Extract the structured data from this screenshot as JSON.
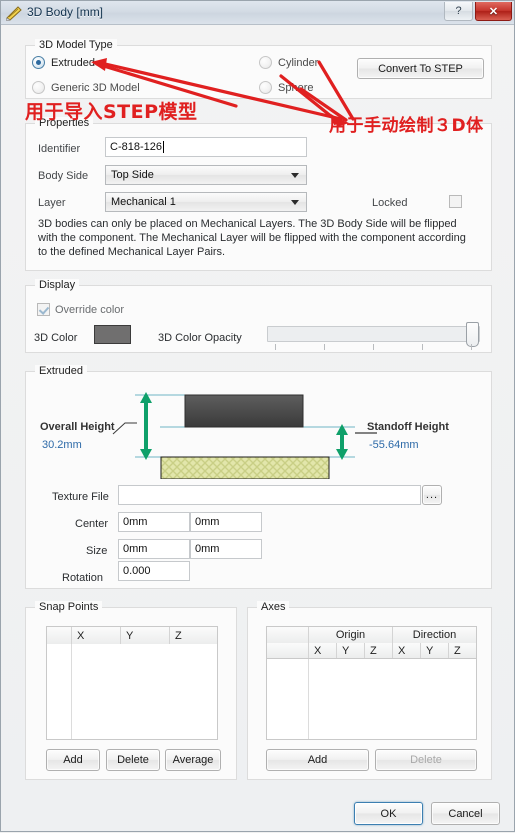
{
  "window": {
    "title": "3D Body [mm]",
    "icon": "3d-body-icon",
    "help_label": "?",
    "close_label": "✕"
  },
  "model_type": {
    "group_title": "3D Model Type",
    "options": [
      {
        "label": "Extruded",
        "selected": true
      },
      {
        "label": "Generic 3D Model",
        "selected": false
      },
      {
        "label": "Cylinder",
        "selected": false
      },
      {
        "label": "Sphere",
        "selected": false
      }
    ],
    "convert_button": "Convert To STEP"
  },
  "properties": {
    "group_title": "Properties",
    "identifier_label": "Identifier",
    "identifier_value": "C-818-126",
    "body_side_label": "Body Side",
    "body_side_value": "Top Side",
    "layer_label": "Layer",
    "layer_value": "Mechanical 1",
    "locked_label": "Locked",
    "locked_checked": false,
    "note": "3D bodies can only be placed on Mechanical Layers. The 3D Body Side will be flipped with the component. The Mechanical Layer will be flipped with the component according to the defined Mechanical Layer Pairs."
  },
  "display": {
    "group_title": "Display",
    "override_color_label": "Override color",
    "override_color_checked": true,
    "color_label": "3D Color",
    "color_value": "#706f6f",
    "opacity_label": "3D Color Opacity",
    "opacity_percent": 100
  },
  "extruded": {
    "group_title": "Extruded",
    "overall_height_label": "Overall Height",
    "overall_height_value": "30.2mm",
    "standoff_height_label": "Standoff Height",
    "standoff_height_value": "-55.64mm",
    "arrow_color": "#0fa06a",
    "guide_color": "#2f8fa0",
    "top_block_color": "#4a4a4a",
    "bottom_block_color": "#dbdf9e",
    "texture_file_label": "Texture File",
    "texture_file_value": "",
    "browse_label": "...",
    "center_label": "Center",
    "center_x": "0mm",
    "center_y": "0mm",
    "size_label": "Size",
    "size_x": "0mm",
    "size_y": "0mm",
    "rotation_label": "Rotation",
    "rotation_value": "0.000"
  },
  "snap_points": {
    "group_title": "Snap Points",
    "columns": [
      "",
      "X",
      "Y",
      "Z"
    ],
    "rows": [],
    "buttons": [
      "Add",
      "Delete",
      "Average"
    ]
  },
  "axes": {
    "group_title": "Axes",
    "header_top": [
      "",
      "Origin",
      "Direction"
    ],
    "header_sub": [
      "",
      "X",
      "Y",
      "Z",
      "X",
      "Y",
      "Z"
    ],
    "rows": [],
    "buttons": [
      {
        "label": "Add",
        "enabled": true
      },
      {
        "label": "Delete",
        "enabled": false
      }
    ]
  },
  "footer": {
    "ok_label": "OK",
    "cancel_label": "Cancel"
  },
  "annotations": {
    "color": "#e02020",
    "note_left": "用于导入STEP模型",
    "note_right": "用于手动绘制３D体"
  }
}
